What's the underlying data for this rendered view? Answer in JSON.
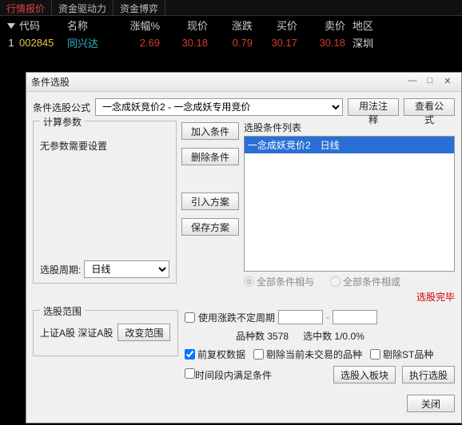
{
  "tabs": [
    "行情报价",
    "资金驱动力",
    "资金博弈"
  ],
  "header": {
    "code": "代码",
    "name": "名称",
    "chgPct": "涨幅%",
    "price": "现价",
    "diff": "涨跌",
    "bid": "买价",
    "ask": "卖价",
    "area": "地区"
  },
  "row": {
    "idx": "1",
    "code": "002845",
    "name": "同兴达",
    "chgPct": "2.69",
    "price": "30.18",
    "diff": "0.79",
    "bid": "30.17",
    "ask": "30.18",
    "area": "深圳"
  },
  "dialog": {
    "title": "条件选股",
    "formulaLabel": "条件选股公式",
    "formulaValue": "一念成妖竞价2 - 一念成妖专用竞价",
    "btnUsage": "用法注释",
    "btnViewFormula": "查看公式",
    "paramsLegend": "计算参数",
    "noParams": "无参数需要设置",
    "periodLabel": "选股周期:",
    "periodValue": "日线",
    "btnAdd": "加入条件",
    "btnDel": "删除条件",
    "btnImport": "引入方案",
    "btnSave": "保存方案",
    "condListLabel": "选股条件列表",
    "condItem": "一念成妖竞价2　日线",
    "radioAll": "全部条件相与",
    "radioOr": "全部条件相或",
    "statusDone": "选股完毕",
    "scopeLegend": "选股范围",
    "scopeText": "上证A股 深证A股",
    "btnChangeScope": "改变范围",
    "chkUsePeriod": "使用涨跌不定周期",
    "lblCount": "品种数",
    "countVal": "3578",
    "lblHit": "选中数",
    "hitVal": "1/0.0%",
    "chkFQ": "前复权数据",
    "chkExclNoTrade": "剔除当前未交易的品种",
    "chkExclST": "剔除ST品种",
    "chkTimeRange": "时间段内满足条件",
    "btnPickBlock": "选股入板块",
    "btnExec": "执行选股",
    "btnClose": "关闭"
  }
}
